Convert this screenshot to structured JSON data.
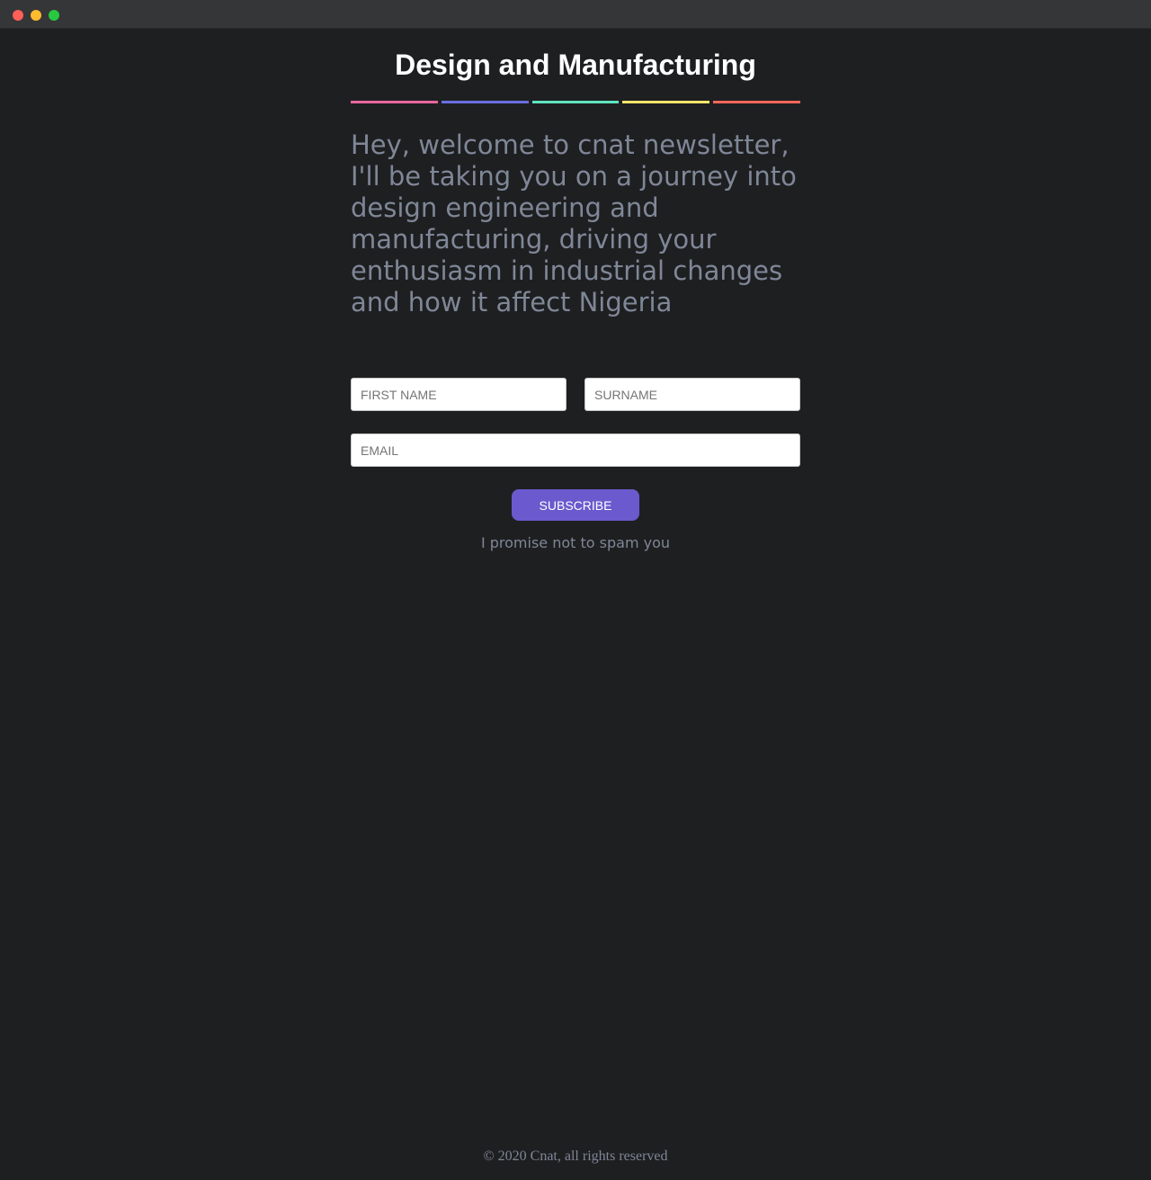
{
  "window": {
    "controls": [
      "close",
      "minimize",
      "maximize"
    ],
    "colors": {
      "close": "#fe5f57",
      "minimize": "#febc2e",
      "maximize": "#28c840"
    }
  },
  "header": {
    "title": "Design and Manufacturing",
    "stripe_colors": [
      "#e8659f",
      "#6a6ee0",
      "#5fe3c0",
      "#f6e66b",
      "#f2675a"
    ]
  },
  "intro": {
    "text": "Hey, welcome to cnat newsletter, I'll be taking you on a journey into design engineering and manufacturing, driving your enthusiasm in industrial changes and how it affect Nigeria"
  },
  "form": {
    "first_name_placeholder": "FIRST NAME",
    "surname_placeholder": "SURNAME",
    "email_placeholder": "EMAIL",
    "subscribe_label": "SUBSCRIBE",
    "note": "I promise not to spam you"
  },
  "footer": {
    "text": "© 2020 Cnat, all rights reserved"
  },
  "colors": {
    "background": "#1e1f21",
    "accent": "#6a5acd",
    "muted_text": "#7f8797"
  }
}
